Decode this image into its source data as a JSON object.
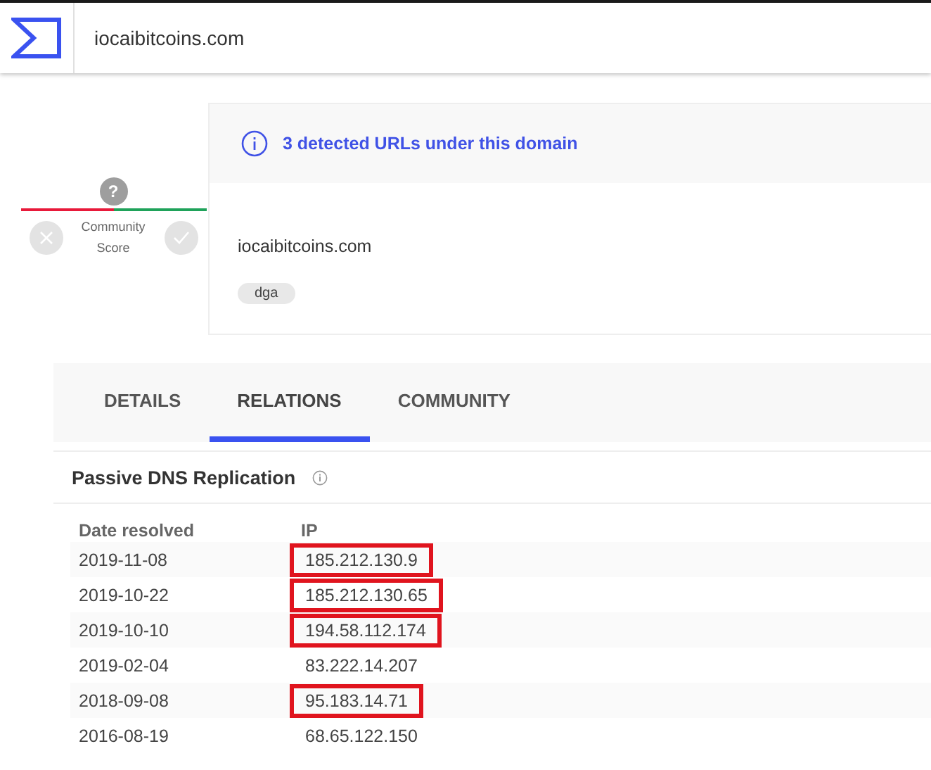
{
  "search": {
    "value": "iocaibitcoins.com"
  },
  "community_score": {
    "marker": "?",
    "label": "Community Score"
  },
  "detections": {
    "banner": "3 detected URLs under this domain"
  },
  "domain": {
    "name": "iocaibitcoins.com",
    "tags": [
      "dga"
    ]
  },
  "tabs": [
    {
      "label": "DETAILS",
      "selected": false
    },
    {
      "label": "RELATIONS",
      "selected": true
    },
    {
      "label": "COMMUNITY",
      "selected": false
    }
  ],
  "passive_dns": {
    "title": "Passive DNS Replication",
    "columns": [
      "Date resolved",
      "IP"
    ],
    "rows": [
      {
        "date": "2019-11-08",
        "ip": "185.212.130.9",
        "highlighted": true
      },
      {
        "date": "2019-10-22",
        "ip": "185.212.130.65",
        "highlighted": true
      },
      {
        "date": "2019-10-10",
        "ip": "194.58.112.174",
        "highlighted": true
      },
      {
        "date": "2019-02-04",
        "ip": "83.222.14.207",
        "highlighted": false
      },
      {
        "date": "2018-09-08",
        "ip": "95.183.14.71",
        "highlighted": true
      },
      {
        "date": "2016-08-19",
        "ip": "68.65.122.150",
        "highlighted": false
      }
    ]
  }
}
